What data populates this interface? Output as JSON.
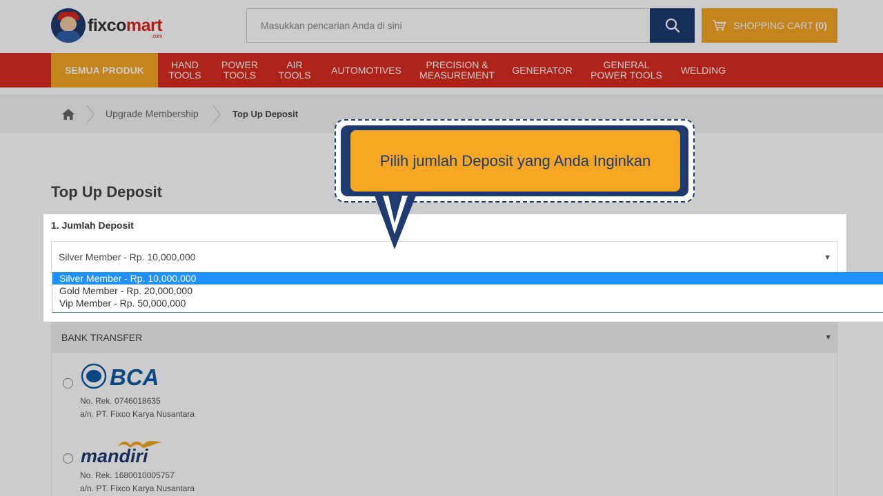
{
  "header": {
    "logo_text_a": "fixco",
    "logo_text_b": "mart",
    "logo_com": ".com",
    "search_placeholder": "Masukkan pencarian Anda di sini",
    "cart_label": "SHOPPING CART",
    "cart_count": "(0)"
  },
  "nav": {
    "all_label": "SEMUA PRODUK",
    "items": [
      {
        "line1": "HAND",
        "line2": "TOOLS"
      },
      {
        "line1": "POWER",
        "line2": "TOOLS"
      },
      {
        "line1": "AIR",
        "line2": "TOOLS"
      },
      {
        "line1": "AUTOMOTIVES",
        "line2": ""
      },
      {
        "line1": "PRECISION &",
        "line2": "MEASUREMENT"
      },
      {
        "line1": "GENERATOR",
        "line2": ""
      },
      {
        "line1": "GENERAL",
        "line2": "POWER TOOLS"
      },
      {
        "line1": "WELDING",
        "line2": ""
      }
    ]
  },
  "breadcrumb": {
    "link": "Upgrade Membership",
    "current": "Top Up Deposit"
  },
  "page": {
    "title": "Top Up Deposit",
    "section_label": "1. Jumlah Deposit",
    "selected_value": "Silver Member - Rp. 10,000,000",
    "options": [
      "Silver Member - Rp. 10,000,000",
      "Gold Member - Rp. 20,000,000",
      "Vip Member - Rp. 50,000,000"
    ]
  },
  "payment": {
    "header": "BANK TRANSFER",
    "banks": [
      {
        "name": "BCA",
        "account": "No. Rek. 0746018635",
        "holder": "a/n. PT. Fixco Karya Nusantara"
      },
      {
        "name": "mandiri",
        "account": "No. Rek. 1680010005757",
        "holder": "a/n. PT. Fixco Karya Nusantara"
      }
    ]
  },
  "tooltip": {
    "text": "Pilih jumlah Deposit yang Anda Inginkan"
  },
  "colors": {
    "brand_red": "#d92b20",
    "brand_orange": "#f5a623",
    "brand_navy": "#1d3b6e",
    "select_highlight": "#1e90ff"
  }
}
